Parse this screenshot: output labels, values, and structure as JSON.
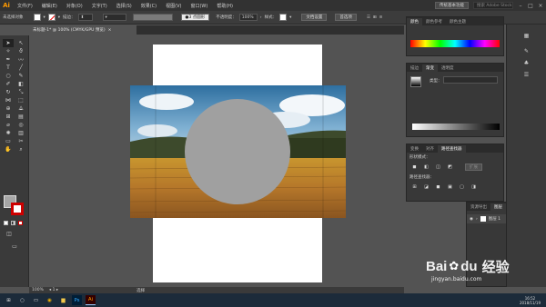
{
  "app": {
    "logo": "Ai"
  },
  "menubar": {
    "items": [
      "文件(F)",
      "编辑(E)",
      "对象(O)",
      "文字(T)",
      "选择(S)",
      "效果(C)",
      "视图(V)",
      "窗口(W)",
      "帮助(H)"
    ],
    "workspace_label": "传统基本功能",
    "search_placeholder": "搜索 Adobe Stock"
  },
  "controlbar": {
    "selection_label": "未选择对象",
    "stroke_label": "描边：",
    "brush_label": "3 点圆形",
    "opacity_label": "不透明度：",
    "opacity_value": "100%",
    "style_label": "样式：",
    "doc_setup": "文档设置",
    "preferences": "首选项"
  },
  "document": {
    "tab_title": "未标题-1* @ 100% (CMYK/GPU 预览)",
    "zoom": "100%",
    "status": "选择"
  },
  "panels": {
    "color": {
      "tabs": [
        "颜色",
        "颜色参考",
        "颜色主题"
      ]
    },
    "gradient": {
      "tabs": [
        "描边",
        "渐变",
        "透明度"
      ],
      "type_label": "类型："
    },
    "pathfinder": {
      "tabs": [
        "变换",
        "对齐",
        "路径查找器"
      ],
      "shape_modes": "形状模式：",
      "pathfinders": "路径查找器：",
      "expand": "扩展"
    },
    "layers": {
      "tabs": [
        "资源导出",
        "图层"
      ],
      "layer_name": "图层 1"
    }
  },
  "taskbar": {
    "time": "16:52",
    "date": "2018/11/19"
  },
  "watermark": {
    "brand": "Bai",
    "brand2": "du",
    "cn": "经验",
    "url": "jingyan.baidu.com"
  },
  "colors": {
    "accent": "#ff9a00",
    "circle": "#a0a0a0",
    "canvas": "#535353"
  }
}
